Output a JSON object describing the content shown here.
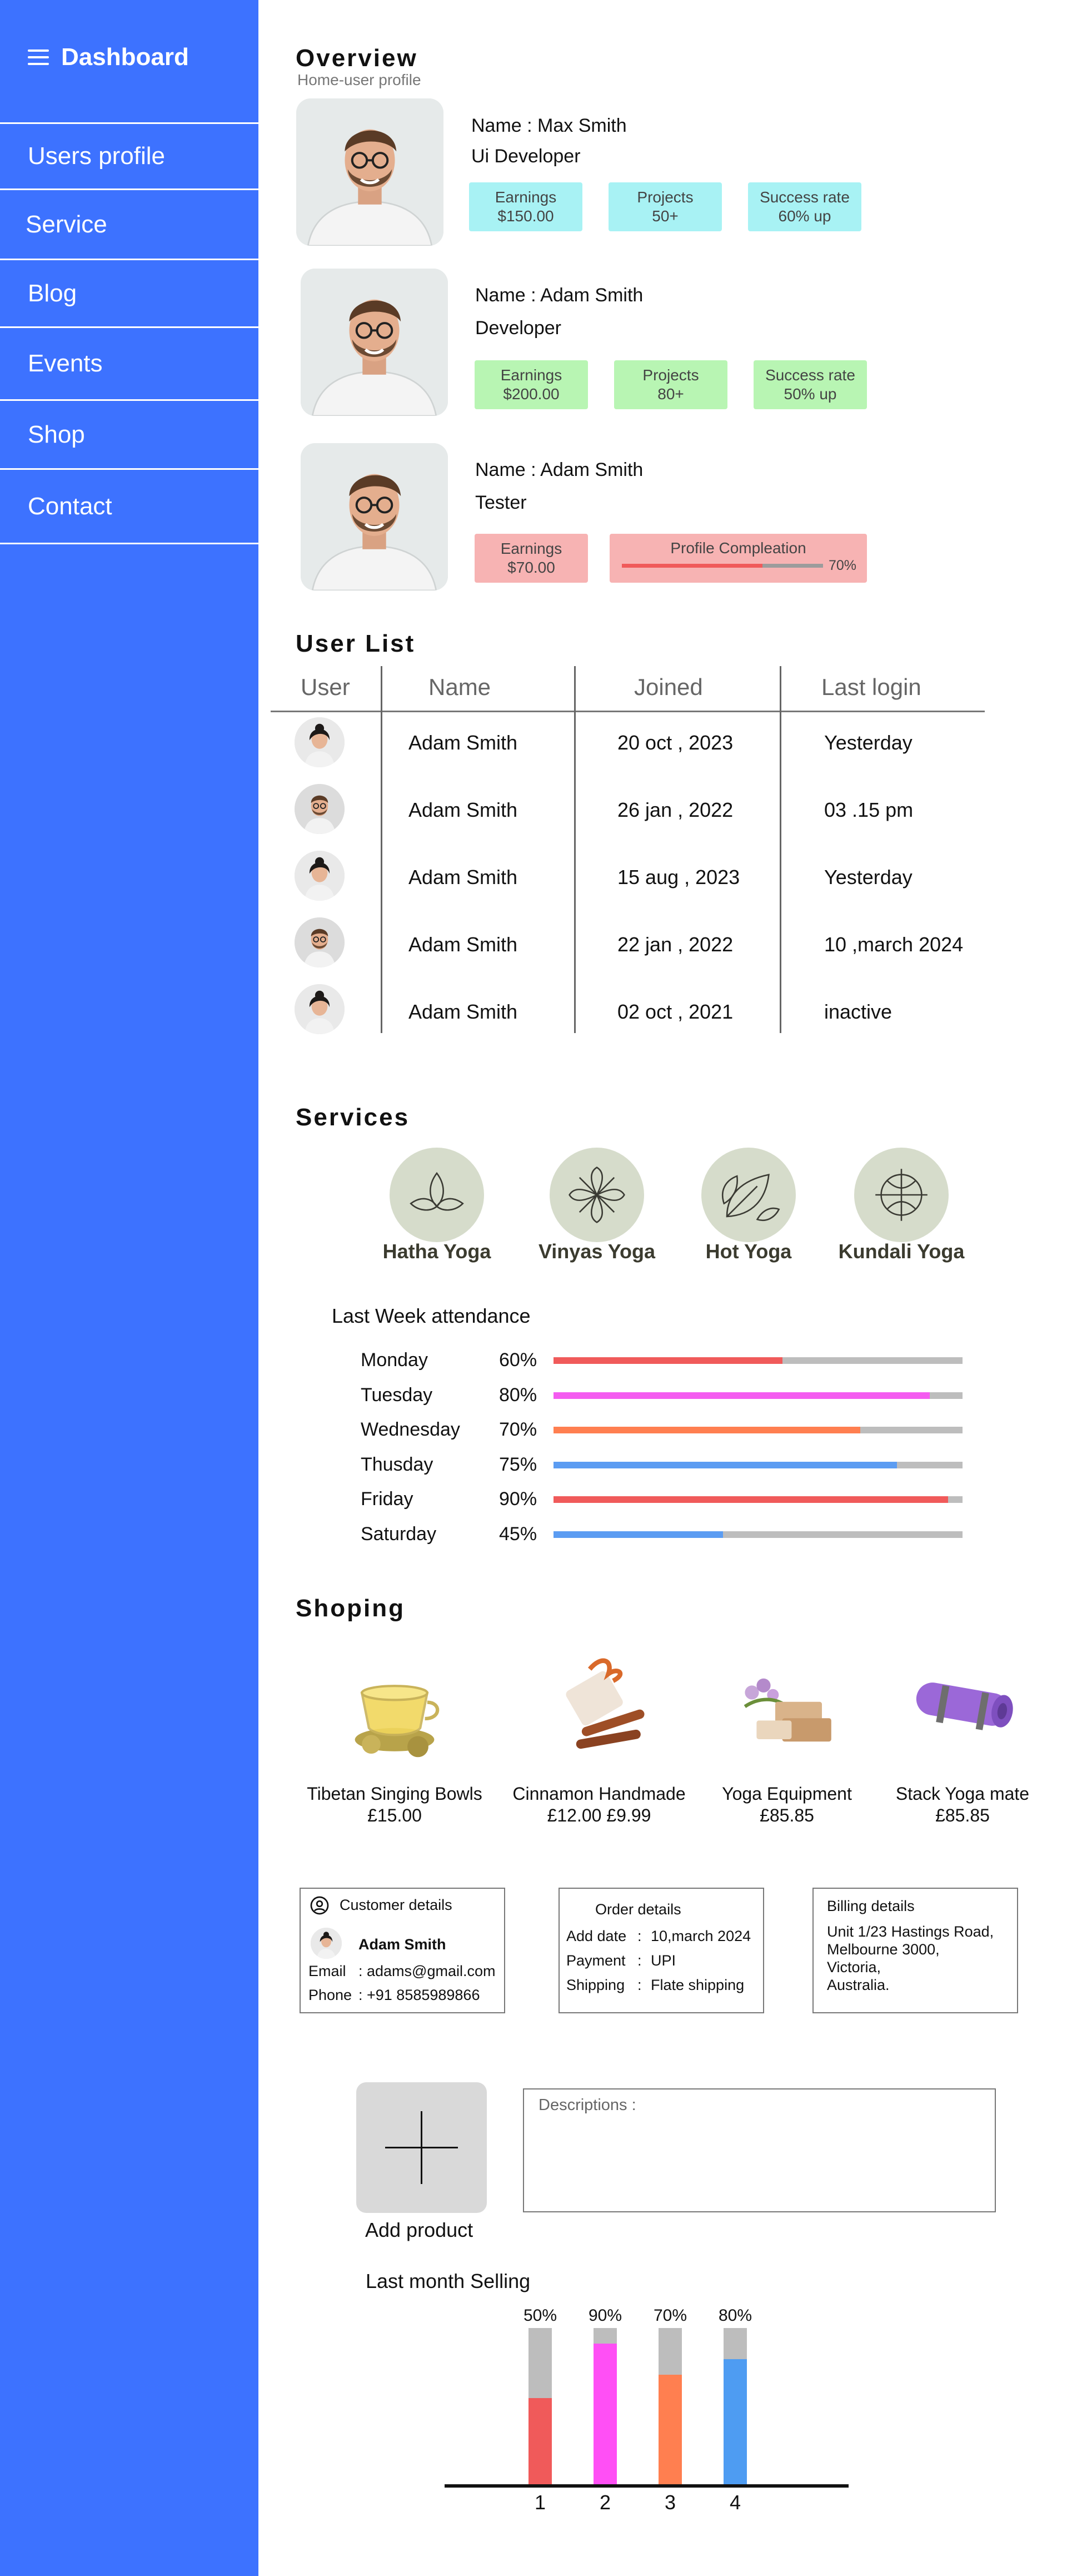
{
  "sidebar": {
    "title": "Dashboard",
    "items": [
      "Users profile",
      "Service",
      "Blog",
      "Events",
      "Shop",
      "Contact"
    ]
  },
  "overview": {
    "title": "Overview",
    "subtitle": "Home-user profile",
    "profiles": [
      {
        "name": "Name : Max Smith",
        "role": "Ui Developer",
        "stats": [
          {
            "label": "Earnings",
            "value": "$150.00"
          },
          {
            "label": "Projects",
            "value": "50+"
          },
          {
            "label": "Success rate",
            "value": "60% up"
          }
        ]
      },
      {
        "name": "Name : Adam Smith",
        "role": "Developer",
        "stats": [
          {
            "label": "Earnings",
            "value": "$200.00"
          },
          {
            "label": "Projects",
            "value": "80+"
          },
          {
            "label": "Success rate",
            "value": "50% up"
          }
        ]
      },
      {
        "name": "Name : Adam Smith",
        "role": "Tester",
        "stats": [
          {
            "label": "Earnings",
            "value": "$70.00"
          }
        ],
        "completion": {
          "label": "Profile Compleation",
          "value": "70%",
          "fraction": 0.7
        }
      }
    ]
  },
  "user_list": {
    "title": "User List",
    "columns": [
      "User",
      "Name",
      "Joined",
      "Last login"
    ],
    "rows": [
      {
        "avatar": "female-avatar",
        "name": "Adam Smith",
        "joined": "20 oct , 2023",
        "last_login": "Yesterday"
      },
      {
        "avatar": "male-avatar",
        "name": "Adam Smith",
        "joined": "26 jan , 2022",
        "last_login": "03 .15 pm"
      },
      {
        "avatar": "female-avatar",
        "name": "Adam Smith",
        "joined": "15 aug , 2023",
        "last_login": "Yesterday"
      },
      {
        "avatar": "male-avatar",
        "name": "Adam Smith",
        "joined": "22 jan , 2022",
        "last_login": "10 ,march 2024"
      },
      {
        "avatar": "female-avatar",
        "name": "Adam Smith",
        "joined": "02 oct , 2021",
        "last_login": "inactive"
      }
    ]
  },
  "services": {
    "title": "Services",
    "items": [
      {
        "label": "Hatha Yoga",
        "icon": "lotus-icon"
      },
      {
        "label": "Vinyas Yoga",
        "icon": "flower-icon"
      },
      {
        "label": "Hot Yoga",
        "icon": "leaf-icon"
      },
      {
        "label": "Kundali Yoga",
        "icon": "symbol-icon"
      }
    ]
  },
  "attendance": {
    "title": "Last Week attendance",
    "days": [
      {
        "day": "Monday",
        "pct": "60%",
        "value": 0.56,
        "color": "#f05a5a"
      },
      {
        "day": "Tuesday",
        "pct": "80%",
        "value": 0.92,
        "color": "#f45cf0"
      },
      {
        "day": "Wednesday",
        "pct": "70%",
        "value": 0.75,
        "color": "#ff7f50"
      },
      {
        "day": "Thusday",
        "pct": "75%",
        "value": 0.84,
        "color": "#5b9cf2"
      },
      {
        "day": "Friday",
        "pct": "90%",
        "value": 0.965,
        "color": "#f05a5a"
      },
      {
        "day": "Saturday",
        "pct": "45%",
        "value": 0.415,
        "color": "#5b9cf2"
      }
    ]
  },
  "shopping": {
    "title": "Shoping",
    "products": [
      {
        "name": "Tibetan Singing Bowls",
        "price": "£15.00",
        "icon": "tea-cup-icon"
      },
      {
        "name": "Cinnamon Handmade",
        "price": "£12.00 £9.99",
        "icon": "cinnamon-icon"
      },
      {
        "name": "Yoga Equipment",
        "price": "£85.85",
        "icon": "soap-icon"
      },
      {
        "name": "Stack Yoga mate",
        "price": "£85.85",
        "icon": "yoga-mat-icon"
      }
    ]
  },
  "customer": {
    "heading": "Customer details",
    "name": "Adam Smith",
    "email_label": "Email",
    "email": ": adams@gmail.com",
    "phone_label": "Phone",
    "phone": ": +91 8585989866"
  },
  "order": {
    "heading": "Order details",
    "rows": [
      {
        "label": "Add date",
        "sep": ":",
        "value": "10,march 2024"
      },
      {
        "label": "Payment",
        "sep": ":",
        "value": "UPI"
      },
      {
        "label": "Shipping",
        "sep": ":",
        "value": "Flate shipping"
      }
    ]
  },
  "billing": {
    "heading": "Billing details",
    "lines": [
      "Unit 1/23 Hastings Road,",
      "Melbourne 3000,",
      "Victoria,",
      "Australia."
    ]
  },
  "add_product": {
    "label": "Add product",
    "description_label": "Descriptions :"
  },
  "chart_data": {
    "type": "bar",
    "title": "Last month Selling",
    "categories": [
      "1",
      "2",
      "3",
      "4"
    ],
    "values": [
      50,
      90,
      70,
      80
    ],
    "labels": [
      "50%",
      "90%",
      "70%",
      "80%"
    ],
    "colors": [
      "#f05a5a",
      "#ff4ff5",
      "#ff7f50",
      "#4e9cf2"
    ],
    "ylim": [
      0,
      100
    ]
  }
}
